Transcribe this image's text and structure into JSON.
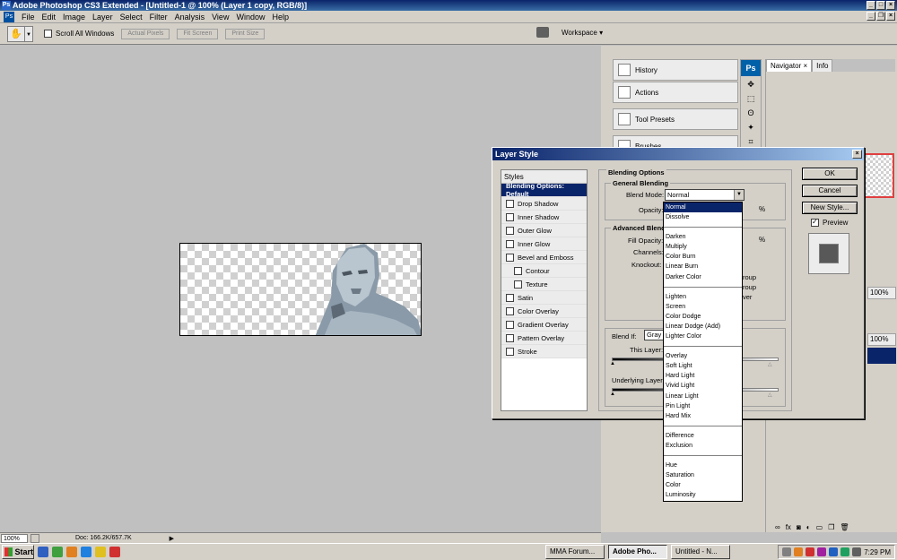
{
  "app": {
    "title": "Adobe Photoshop CS3 Extended - [Untitled-1 @ 100% (Layer 1 copy, RGB/8)]",
    "icon": "Ps"
  },
  "menu": [
    "File",
    "Edit",
    "Image",
    "Layer",
    "Select",
    "Filter",
    "Analysis",
    "View",
    "Window",
    "Help"
  ],
  "options": {
    "scroll_all": "Scroll All Windows",
    "actual_pixels": "Actual Pixels",
    "fit_screen": "Fit Screen",
    "print_size": "Print Size",
    "workspace": "Workspace ▾"
  },
  "panels": {
    "history": "History",
    "actions": "Actions",
    "tool_presets": "Tool Presets",
    "brushes": "Brushes",
    "ps_logo": "Ps",
    "navigator_tab": "Navigator ×",
    "info_tab": "Info",
    "layer_pct1": "100%",
    "layer_pct2": "100%"
  },
  "status": {
    "zoom": "100%",
    "doc": "Doc: 166.2K/657.7K"
  },
  "dialog": {
    "title": "Layer Style",
    "styles_header": "Styles",
    "styles": [
      {
        "label": "Blending Options: Default",
        "checkbox": false,
        "selected": true,
        "sub": false
      },
      {
        "label": "Drop Shadow",
        "checkbox": true,
        "selected": false,
        "sub": false
      },
      {
        "label": "Inner Shadow",
        "checkbox": true,
        "selected": false,
        "sub": false
      },
      {
        "label": "Outer Glow",
        "checkbox": true,
        "selected": false,
        "sub": false
      },
      {
        "label": "Inner Glow",
        "checkbox": true,
        "selected": false,
        "sub": false
      },
      {
        "label": "Bevel and Emboss",
        "checkbox": true,
        "selected": false,
        "sub": false
      },
      {
        "label": "Contour",
        "checkbox": true,
        "selected": false,
        "sub": true
      },
      {
        "label": "Texture",
        "checkbox": true,
        "selected": false,
        "sub": true
      },
      {
        "label": "Satin",
        "checkbox": true,
        "selected": false,
        "sub": false
      },
      {
        "label": "Color Overlay",
        "checkbox": true,
        "selected": false,
        "sub": false
      },
      {
        "label": "Gradient Overlay",
        "checkbox": true,
        "selected": false,
        "sub": false
      },
      {
        "label": "Pattern Overlay",
        "checkbox": true,
        "selected": false,
        "sub": false
      },
      {
        "label": "Stroke",
        "checkbox": true,
        "selected": false,
        "sub": false
      }
    ],
    "blending_options": "Blending Options",
    "general_blending": "General Blending",
    "blend_mode_label": "Blend Mode:",
    "blend_mode_value": "Normal",
    "opacity_label": "Opacity:",
    "pct": "%",
    "advanced_blending": "Advanced Blend",
    "fill_opacity_label": "Fill Opacity:",
    "channels_label": "Channels:",
    "knockout_label": "Knockout:",
    "roup1": "roup",
    "roup2": "roup",
    "ver": "ver",
    "blend_if_label": "Blend If:",
    "blend_if_value": "Gray",
    "this_layer": "This Layer:",
    "underlying_layer": "Underlying Layer:",
    "ok": "OK",
    "cancel": "Cancel",
    "new_style": "New Style...",
    "preview": "Preview"
  },
  "blend_modes": [
    {
      "label": "Normal",
      "sel": true
    },
    {
      "label": "Dissolve"
    },
    {
      "sep": true
    },
    {
      "label": "Darken"
    },
    {
      "label": "Multiply"
    },
    {
      "label": "Color Burn"
    },
    {
      "label": "Linear Burn"
    },
    {
      "label": "Darker Color"
    },
    {
      "sep": true
    },
    {
      "label": "Lighten"
    },
    {
      "label": "Screen"
    },
    {
      "label": "Color Dodge"
    },
    {
      "label": "Linear Dodge (Add)"
    },
    {
      "label": "Lighter Color"
    },
    {
      "sep": true
    },
    {
      "label": "Overlay"
    },
    {
      "label": "Soft Light"
    },
    {
      "label": "Hard Light"
    },
    {
      "label": "Vivid Light"
    },
    {
      "label": "Linear Light"
    },
    {
      "label": "Pin Light"
    },
    {
      "label": "Hard Mix"
    },
    {
      "sep": true
    },
    {
      "label": "Difference"
    },
    {
      "label": "Exclusion"
    },
    {
      "sep": true
    },
    {
      "label": "Hue"
    },
    {
      "label": "Saturation"
    },
    {
      "label": "Color"
    },
    {
      "label": "Luminosity"
    }
  ],
  "taskbar": {
    "start": "Start",
    "tasks": [
      {
        "label": "MMA Forum...",
        "active": false
      },
      {
        "label": "Adobe Pho...",
        "active": true
      },
      {
        "label": "Untitled - N...",
        "active": false
      }
    ],
    "clock": "7:29 PM"
  },
  "colors": {
    "selection": "#0a246a",
    "chrome": "#d4d0c8",
    "canvas_bg": "#c0c0c0"
  }
}
